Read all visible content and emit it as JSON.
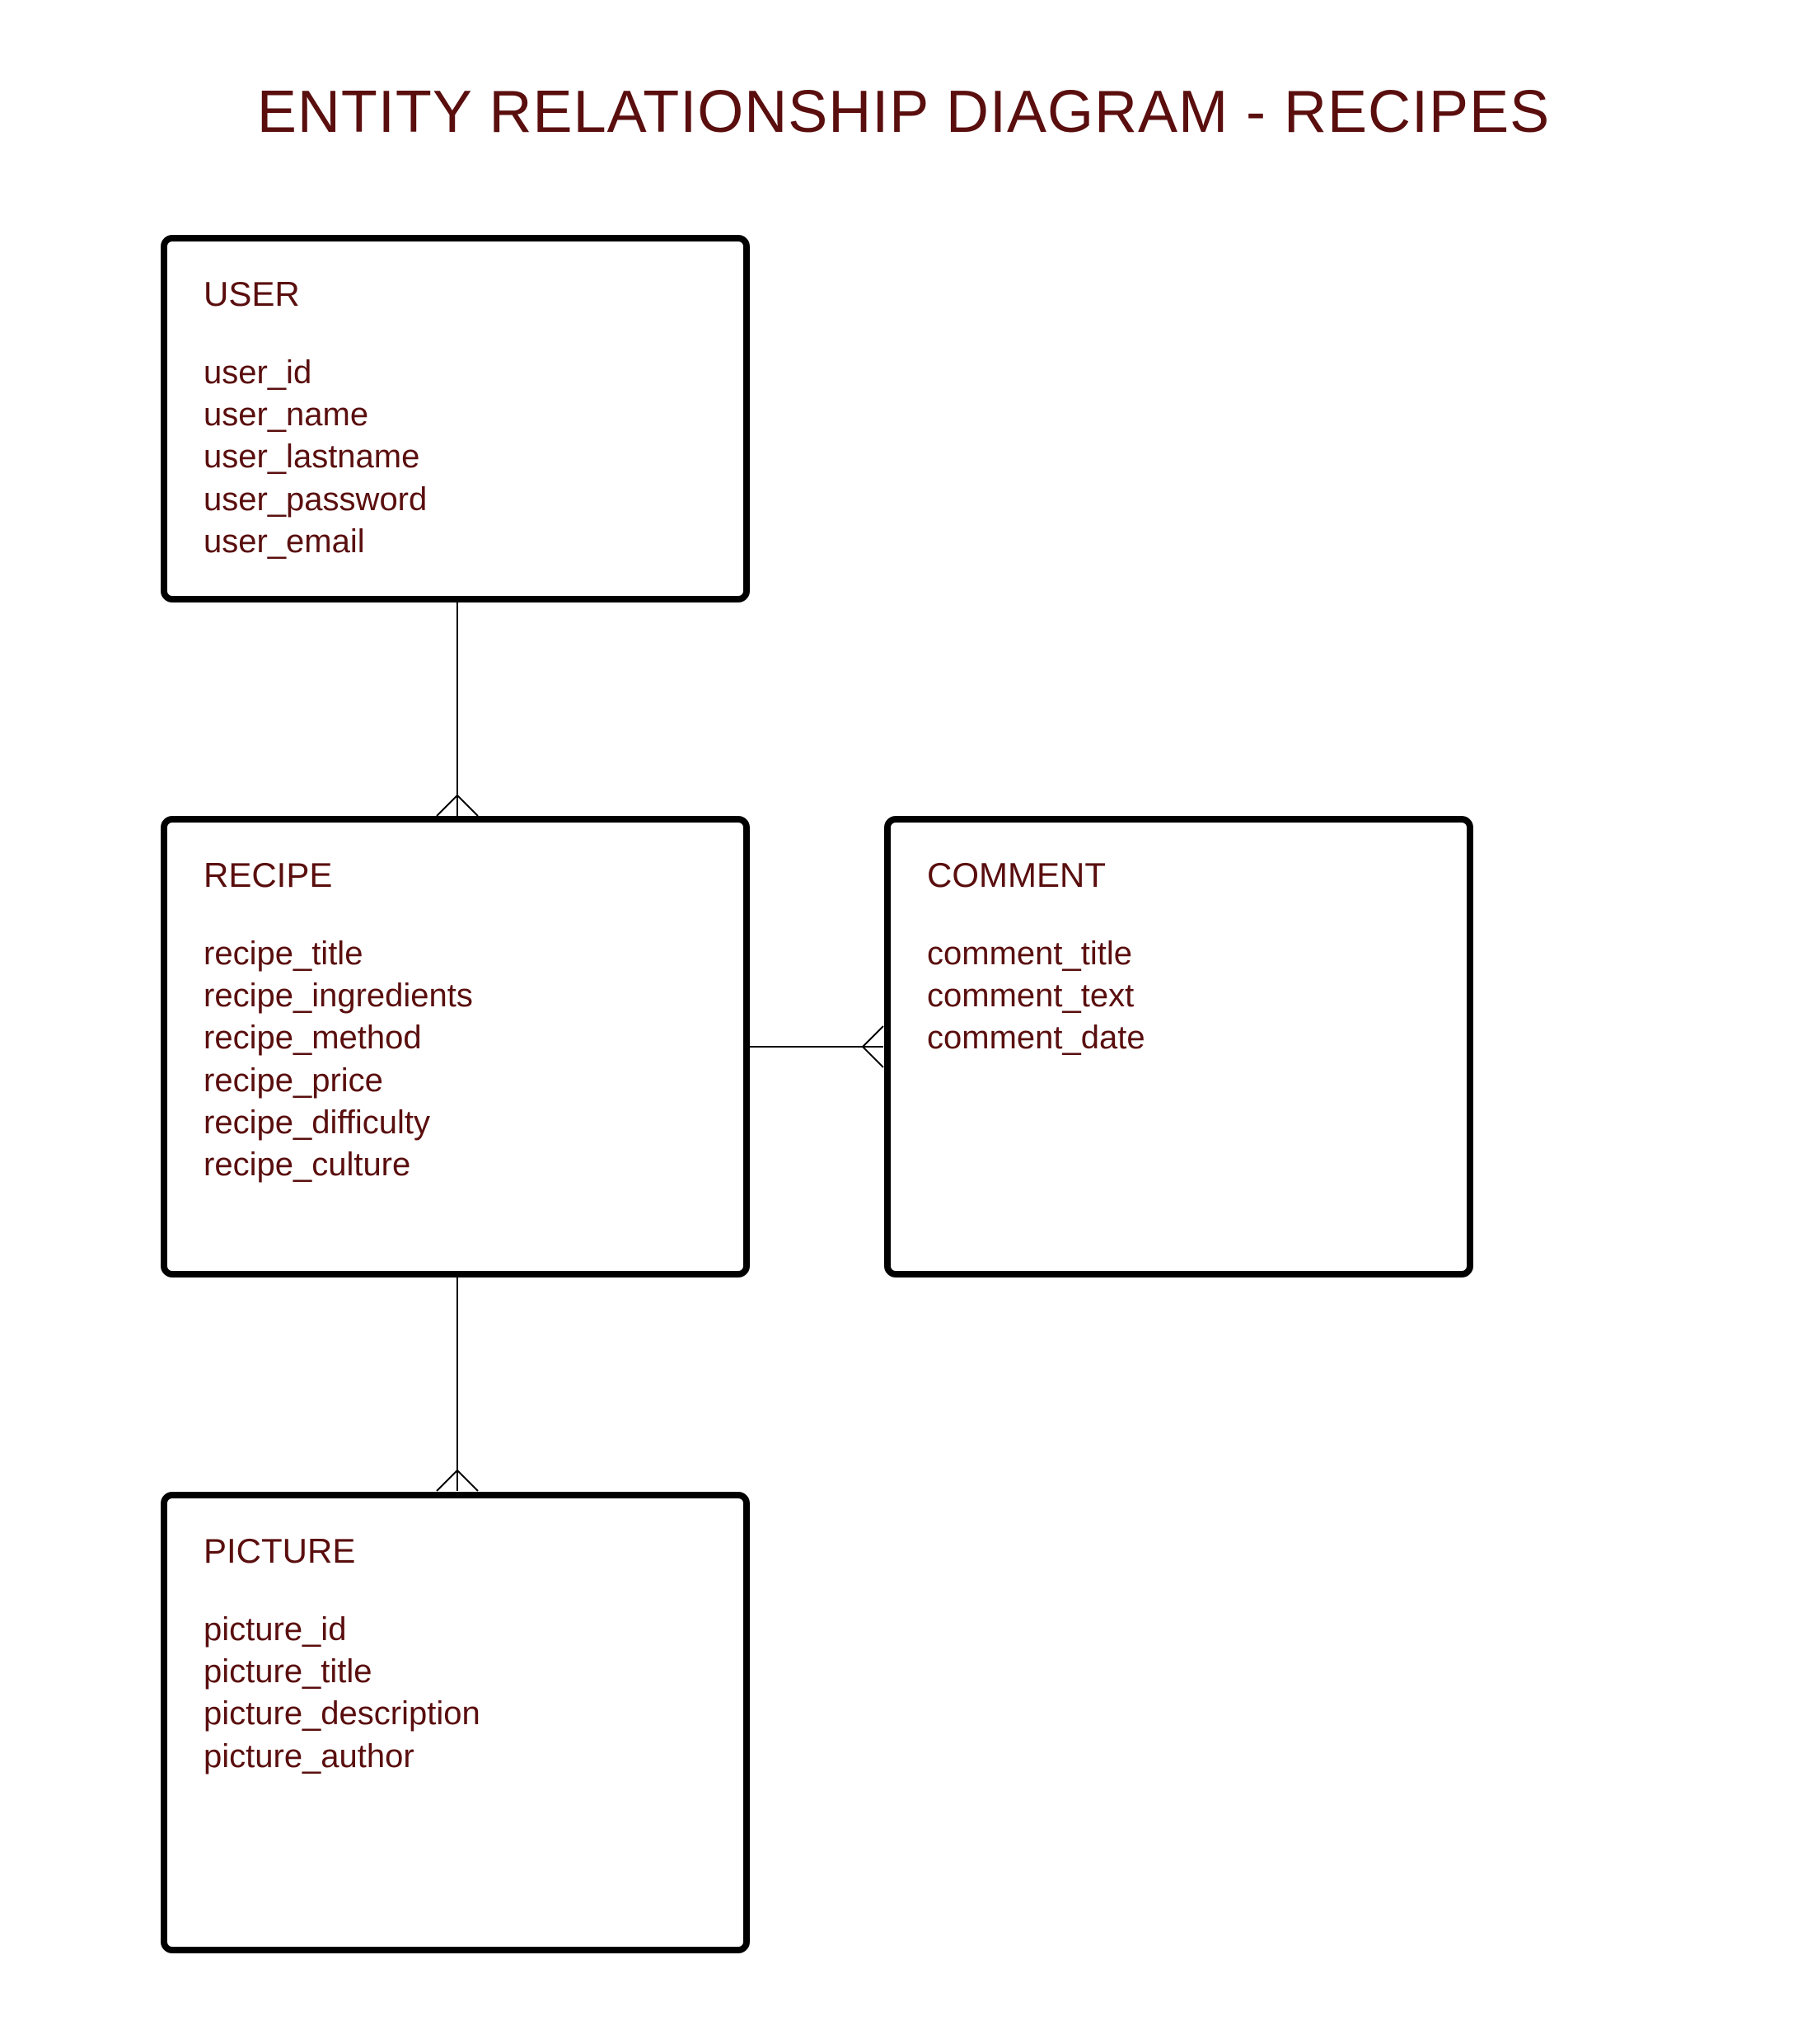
{
  "title": "ENTITY RELATIONSHIP DIAGRAM - RECIPES",
  "entities": {
    "user": {
      "name": "USER",
      "attrs": [
        "user_id",
        "user_name",
        "user_lastname",
        "user_password",
        "user_email"
      ]
    },
    "recipe": {
      "name": "RECIPE",
      "attrs": [
        "recipe_title",
        "recipe_ingredients",
        "recipe_method",
        "recipe_price",
        "recipe_difficulty",
        "recipe_culture"
      ]
    },
    "comment": {
      "name": "COMMENT",
      "attrs": [
        "comment_title",
        "comment_text",
        "comment_date"
      ]
    },
    "picture": {
      "name": "PICTURE",
      "attrs": [
        "picture_id",
        "picture_title",
        "picture_description",
        "picture_author"
      ]
    }
  }
}
